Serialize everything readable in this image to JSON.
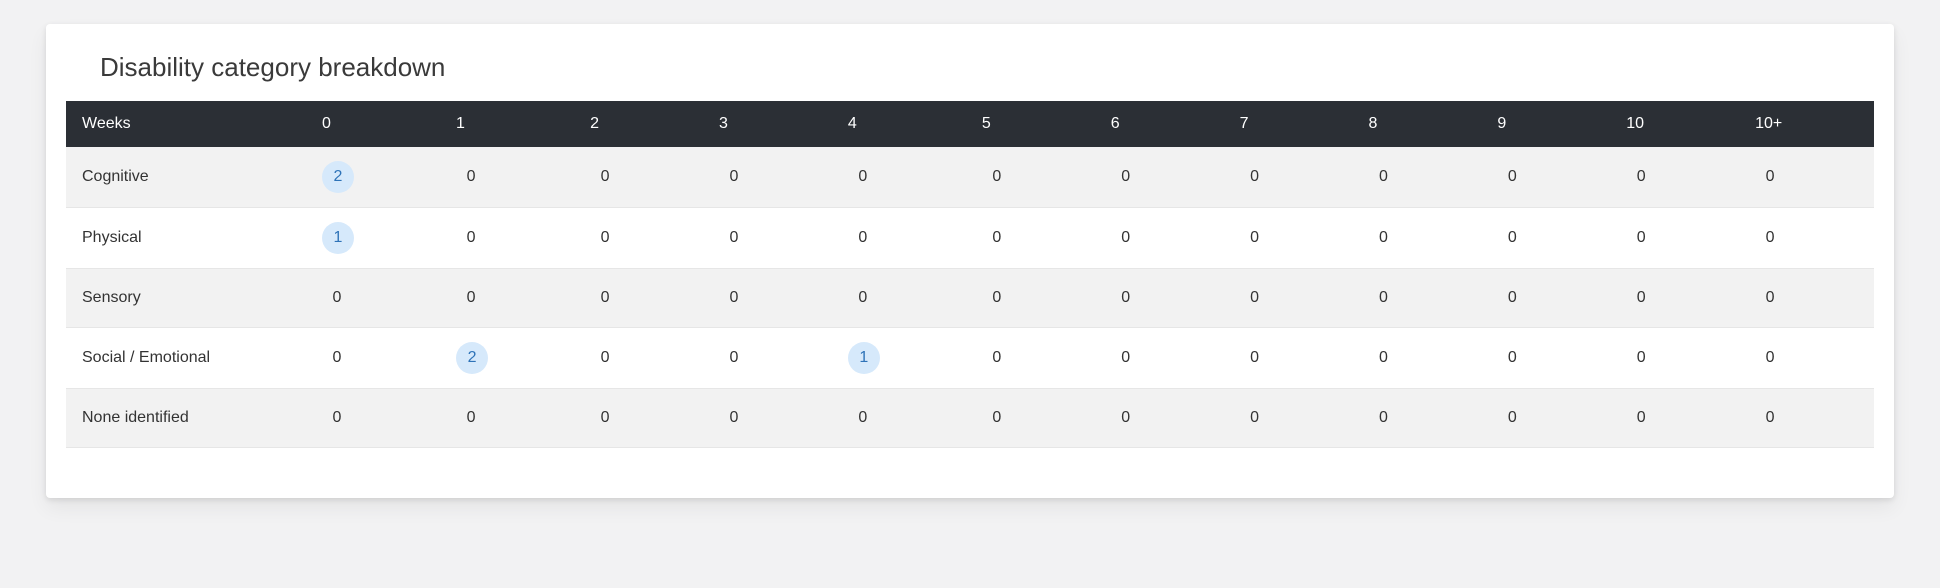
{
  "title": "Disability category breakdown",
  "headerLabel": "Weeks",
  "columns": [
    "0",
    "1",
    "2",
    "3",
    "4",
    "5",
    "6",
    "7",
    "8",
    "9",
    "10",
    "10+"
  ],
  "rows": [
    {
      "label": "Cognitive",
      "cells": [
        {
          "value": "2",
          "highlight": true
        },
        {
          "value": "0",
          "highlight": false
        },
        {
          "value": "0",
          "highlight": false
        },
        {
          "value": "0",
          "highlight": false
        },
        {
          "value": "0",
          "highlight": false
        },
        {
          "value": "0",
          "highlight": false
        },
        {
          "value": "0",
          "highlight": false
        },
        {
          "value": "0",
          "highlight": false
        },
        {
          "value": "0",
          "highlight": false
        },
        {
          "value": "0",
          "highlight": false
        },
        {
          "value": "0",
          "highlight": false
        },
        {
          "value": "0",
          "highlight": false
        }
      ]
    },
    {
      "label": "Physical",
      "cells": [
        {
          "value": "1",
          "highlight": true
        },
        {
          "value": "0",
          "highlight": false
        },
        {
          "value": "0",
          "highlight": false
        },
        {
          "value": "0",
          "highlight": false
        },
        {
          "value": "0",
          "highlight": false
        },
        {
          "value": "0",
          "highlight": false
        },
        {
          "value": "0",
          "highlight": false
        },
        {
          "value": "0",
          "highlight": false
        },
        {
          "value": "0",
          "highlight": false
        },
        {
          "value": "0",
          "highlight": false
        },
        {
          "value": "0",
          "highlight": false
        },
        {
          "value": "0",
          "highlight": false
        }
      ]
    },
    {
      "label": "Sensory",
      "cells": [
        {
          "value": "0",
          "highlight": false
        },
        {
          "value": "0",
          "highlight": false
        },
        {
          "value": "0",
          "highlight": false
        },
        {
          "value": "0",
          "highlight": false
        },
        {
          "value": "0",
          "highlight": false
        },
        {
          "value": "0",
          "highlight": false
        },
        {
          "value": "0",
          "highlight": false
        },
        {
          "value": "0",
          "highlight": false
        },
        {
          "value": "0",
          "highlight": false
        },
        {
          "value": "0",
          "highlight": false
        },
        {
          "value": "0",
          "highlight": false
        },
        {
          "value": "0",
          "highlight": false
        }
      ]
    },
    {
      "label": "Social / Emotional",
      "cells": [
        {
          "value": "0",
          "highlight": false
        },
        {
          "value": "2",
          "highlight": true
        },
        {
          "value": "0",
          "highlight": false
        },
        {
          "value": "0",
          "highlight": false
        },
        {
          "value": "1",
          "highlight": true
        },
        {
          "value": "0",
          "highlight": false
        },
        {
          "value": "0",
          "highlight": false
        },
        {
          "value": "0",
          "highlight": false
        },
        {
          "value": "0",
          "highlight": false
        },
        {
          "value": "0",
          "highlight": false
        },
        {
          "value": "0",
          "highlight": false
        },
        {
          "value": "0",
          "highlight": false
        }
      ]
    },
    {
      "label": "None identified",
      "cells": [
        {
          "value": "0",
          "highlight": false
        },
        {
          "value": "0",
          "highlight": false
        },
        {
          "value": "0",
          "highlight": false
        },
        {
          "value": "0",
          "highlight": false
        },
        {
          "value": "0",
          "highlight": false
        },
        {
          "value": "0",
          "highlight": false
        },
        {
          "value": "0",
          "highlight": false
        },
        {
          "value": "0",
          "highlight": false
        },
        {
          "value": "0",
          "highlight": false
        },
        {
          "value": "0",
          "highlight": false
        },
        {
          "value": "0",
          "highlight": false
        },
        {
          "value": "0",
          "highlight": false
        }
      ]
    }
  ]
}
